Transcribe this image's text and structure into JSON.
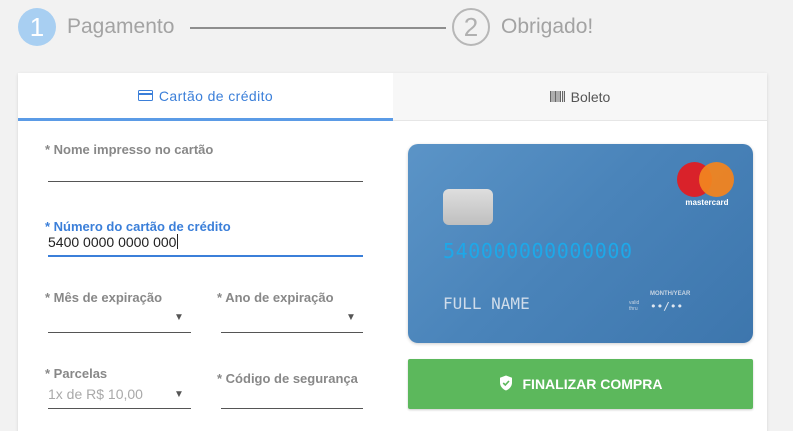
{
  "stepper": {
    "step1_number": "1",
    "step1_label": "Pagamento",
    "step2_number": "2",
    "step2_label": "Obrigado!"
  },
  "tabs": {
    "credit_label": "Cartão de crédito",
    "boleto_label": "Boleto"
  },
  "form": {
    "name_label": "* Nome impresso no cartão",
    "name_value": "",
    "number_label": "* Número do cartão de crédito",
    "number_value": "5400 0000 0000 000",
    "month_label": "* Mês de expiração",
    "year_label": "* Ano de expiração",
    "installments_label": "* Parcelas",
    "installments_value": "1x de R$ 10,00",
    "cvv_label": "* Código de segurança"
  },
  "card": {
    "brand": "mastercard",
    "number": "540000000000000",
    "name": "FULL NAME",
    "valid_line1": "valid",
    "valid_line2": "thru",
    "mmyy_label": "MONTH/YEAR",
    "expiry": "••/••"
  },
  "actions": {
    "finish_label": "FINALIZAR COMPRA"
  },
  "colors": {
    "accent": "#3b7fd9",
    "success": "#5cb85c",
    "card": "#4a84ba"
  }
}
